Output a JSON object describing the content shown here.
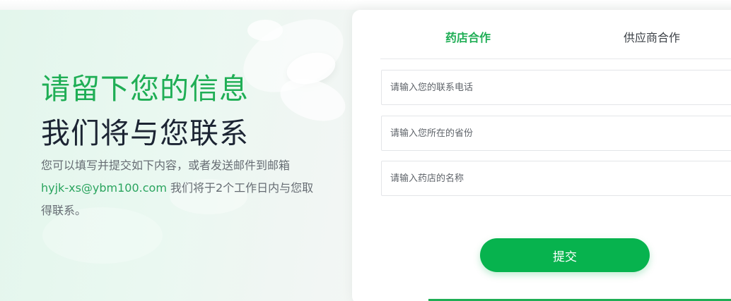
{
  "hero": {
    "headline": "请留下您的信息",
    "subheadline": "我们将与您联系",
    "description_prefix": "您可以填写并提交如下内容，或者发送邮件到邮箱",
    "email": "hyjk-xs@ybm100.com",
    "description_suffix": " 我们将于2个工作日内与您取得联系。"
  },
  "form": {
    "tabs": [
      {
        "label": "药店合作",
        "active": true
      },
      {
        "label": "供应商合作",
        "active": false
      }
    ],
    "fields": {
      "phone": {
        "placeholder": "请输入您的联系电话",
        "value": ""
      },
      "province": {
        "placeholder": "请输入您所在的省份",
        "value": ""
      },
      "store_name": {
        "placeholder": "请输入药店的名称",
        "value": ""
      }
    },
    "submit_label": "提交"
  },
  "colors": {
    "brand_green": "#1fae55",
    "button_green": "#07b34e",
    "dark_text": "#1c2433"
  }
}
